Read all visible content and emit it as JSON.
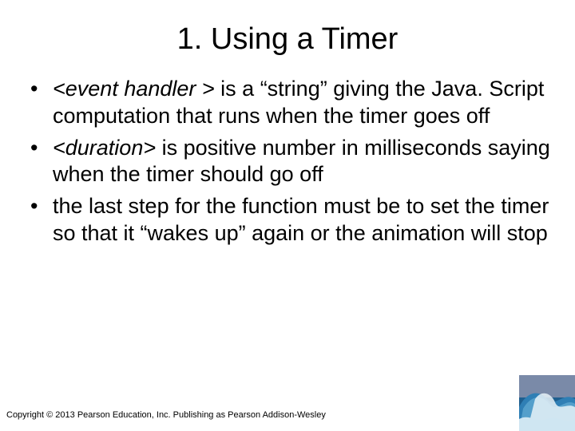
{
  "title": "1. Using a Timer",
  "bullets": [
    {
      "lead_italic": "<event handler >",
      "rest": " is a “string” giving the Java. Script computation that runs when the timer goes off"
    },
    {
      "lead_italic": "<duration>",
      "rest": " is positive number in milliseconds saying when the timer should go off"
    },
    {
      "lead_italic": "",
      "rest": "the last step for the function must be to set the timer so that it “wakes up” again or the animation will stop"
    }
  ],
  "footer": "Copyright © 2013 Pearson Education, Inc. Publishing as Pearson Addison-Wesley"
}
